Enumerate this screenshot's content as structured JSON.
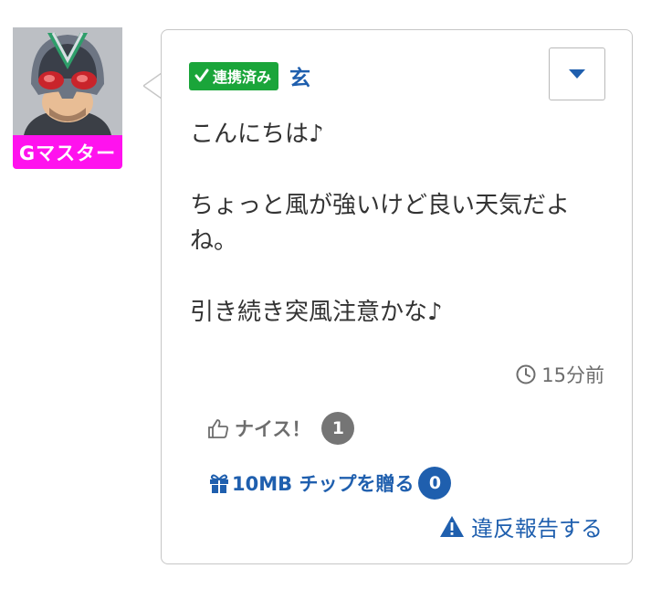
{
  "user": {
    "rank_label": "Gマスター",
    "name": "玄",
    "linked_label": "連携済み"
  },
  "post": {
    "lines": [
      "こんにちは♪",
      "",
      "ちょっと風が強いけど良い天気だよね。",
      "",
      "引き続き突風注意かな♪"
    ],
    "time": "15分前"
  },
  "actions": {
    "nice_label": "ナイス！",
    "nice_count": "1",
    "gift_label": "10MB チップを贈る",
    "gift_count": "0",
    "report_label": "違反報告する"
  },
  "icons": {
    "menu": "chevron-down-icon",
    "time": "clock-icon",
    "nice": "thumbs-up-icon",
    "gift": "gift-icon",
    "report": "warning-icon",
    "linked": "check-icon"
  },
  "colors": {
    "accent_blue": "#1f5fae",
    "linked_green": "#1aa53a",
    "rank_magenta": "#ff12ee",
    "count_gray": "#757575"
  }
}
